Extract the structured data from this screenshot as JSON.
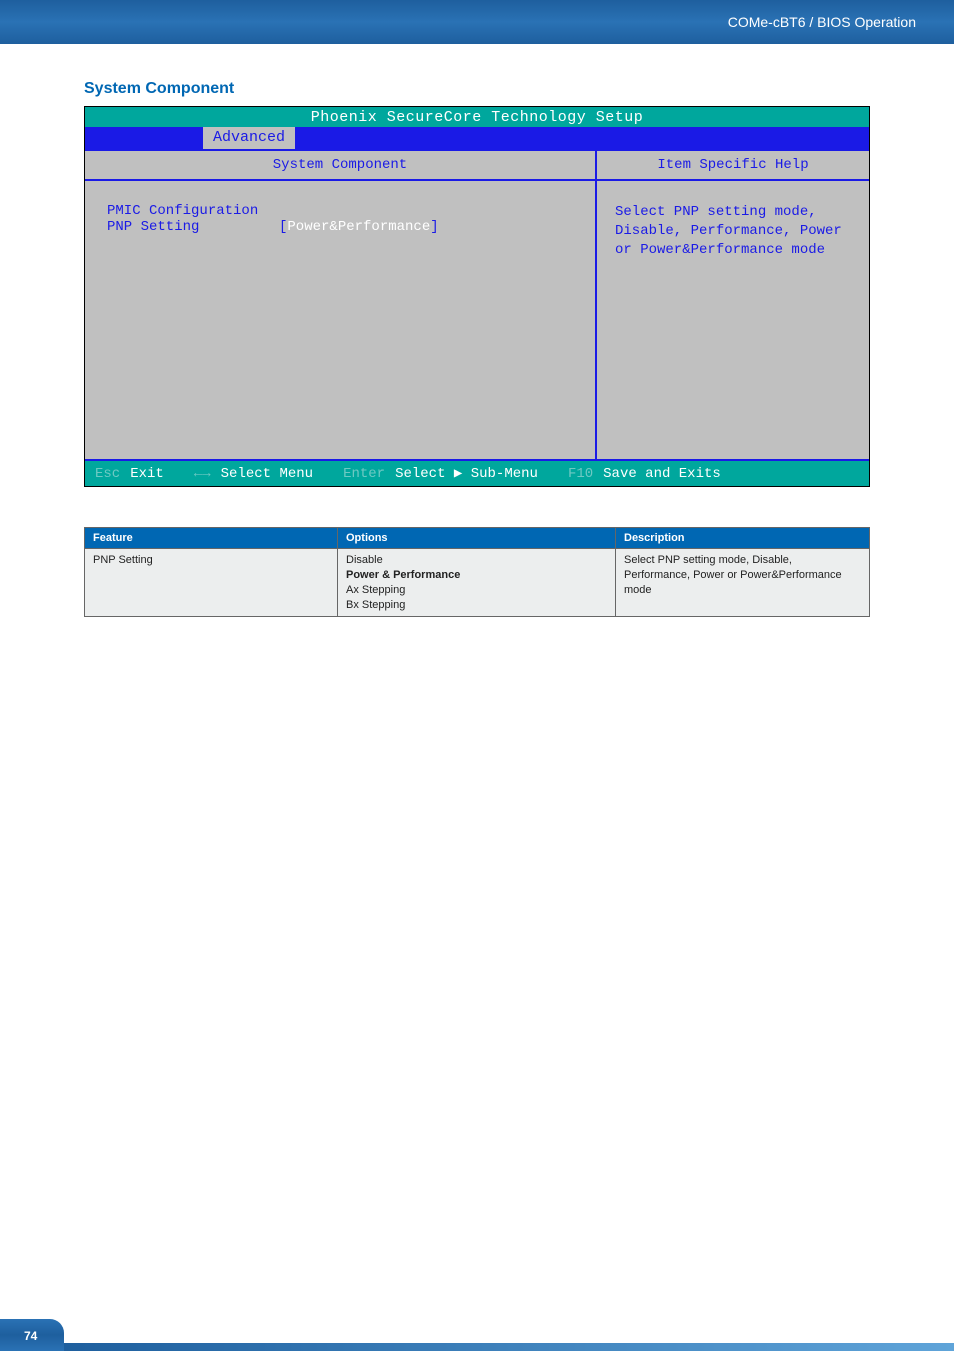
{
  "header": {
    "breadcrumb": "COMe-cBT6 / BIOS Operation"
  },
  "section": {
    "title": "System Component"
  },
  "bios": {
    "title": "Phoenix SecureCore Technology Setup",
    "tab_active": "Advanced",
    "panel_title_left": "System Component",
    "panel_title_right": "Item Specific Help",
    "row1_label": "PMIC Configuration",
    "row2_label": "PNP Setting",
    "row2_value": "Power&Performance",
    "help_text": "Select PNP setting mode, Disable, Performance, Power or Power&Performance mode",
    "footer": {
      "k_esc": "Esc",
      "t_exit": "Exit",
      "k_arrows": "←→",
      "t_selectmenu": "Select Menu",
      "k_enter": "Enter",
      "t_selectsub": "Select ▶ Sub-Menu",
      "k_f10": "F10",
      "t_save": "Save and Exits"
    }
  },
  "table": {
    "headers": {
      "feature": "Feature",
      "options": "Options",
      "description": "Description"
    },
    "rows": [
      {
        "feature": "PNP Setting",
        "opt1": "Disable",
        "opt2": "Power & Performance",
        "opt3": "Ax Stepping",
        "opt4": "Bx Stepping",
        "desc": "Select PNP setting mode, Disable, Performance, Power or Power&Performance mode"
      }
    ]
  },
  "page_number": "74"
}
